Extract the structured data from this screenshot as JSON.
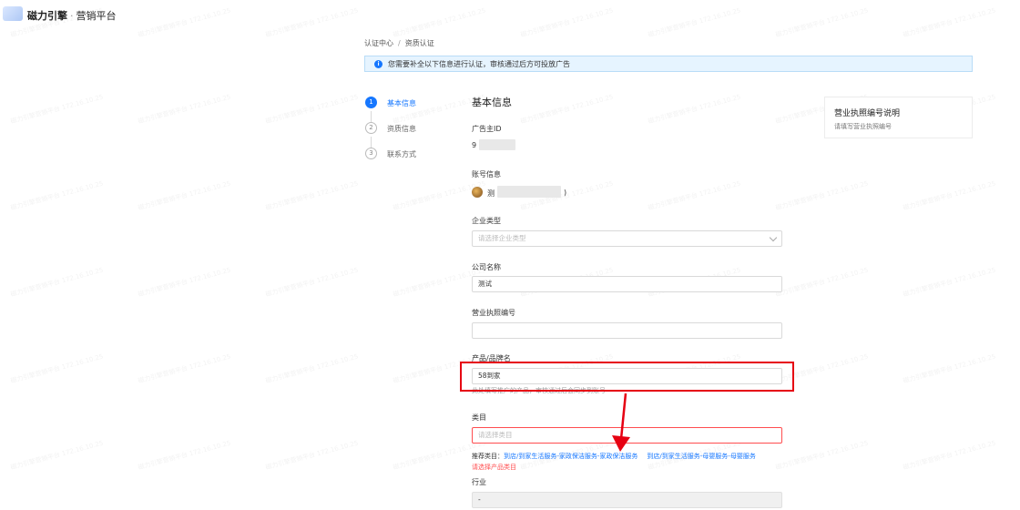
{
  "header": {
    "brand": "磁力引擎",
    "platform": "营销平台"
  },
  "breadcrumb": {
    "root": "认证中心",
    "current": "资质认证"
  },
  "notice": {
    "text": "您需要补全以下信息进行认证，审核通过后方可投放广告"
  },
  "steps": [
    {
      "num": "1",
      "label": "基本信息"
    },
    {
      "num": "2",
      "label": "资质信息"
    },
    {
      "num": "3",
      "label": "联系方式"
    }
  ],
  "form": {
    "title": "基本信息",
    "advertiser_id_label": "广告主ID",
    "advertiser_id_value": "9",
    "account_label": "账号信息",
    "account_value_prefix": "测",
    "account_value_suffix": ")",
    "company_type_label": "企业类型",
    "company_type_placeholder": "请选择企业类型",
    "company_name_label": "公司名称",
    "company_name_value": "测试",
    "license_label": "营业执照编号",
    "license_value": "",
    "product_label": "产品/品牌名",
    "product_value": "58到家",
    "product_helper": "此处填写推广的产品，审核通过后会同步到账号",
    "category_label": "类目",
    "category_placeholder": "请选择类目",
    "recommend_prefix": "推荐类目：",
    "recommend_1": "到店/到家生活服务-家政保洁服务-家政保洁服务",
    "recommend_2": "到店/到家生活服务-母婴服务-母婴服务",
    "category_error": "请选择产品类目",
    "industry_label": "行业",
    "industry_value": "-"
  },
  "help_card": {
    "title": "营业执照编号说明",
    "desc": "请填写营业执照编号"
  },
  "watermark": "磁力引擎营销平台 172.16.10.25"
}
